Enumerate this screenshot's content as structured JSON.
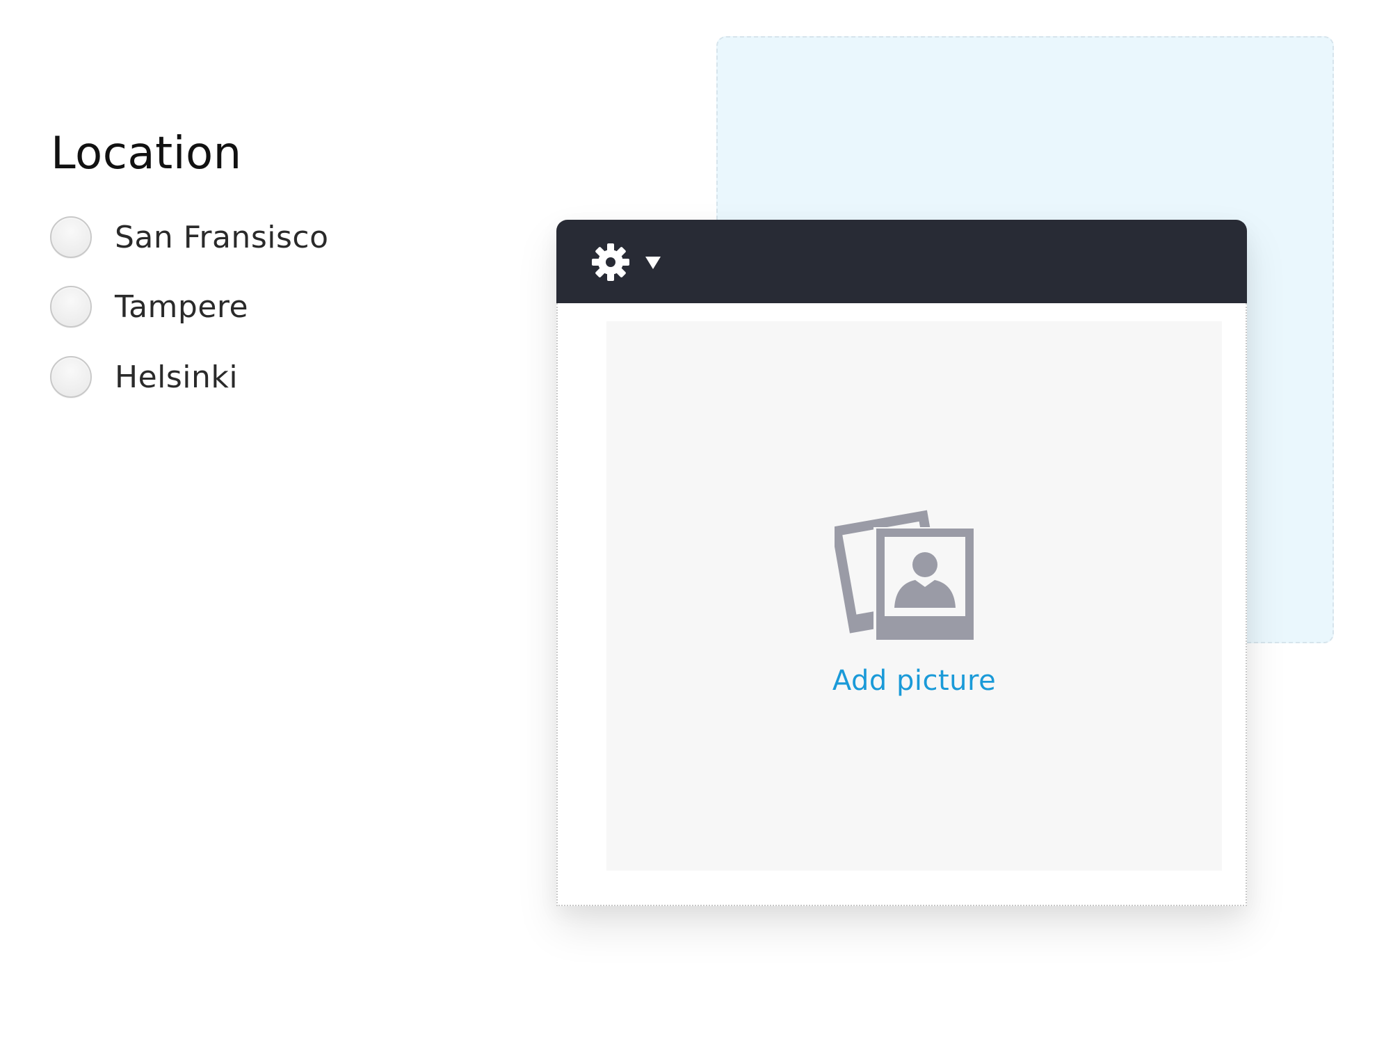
{
  "location": {
    "title": "Location",
    "options": [
      {
        "label": "San Fransisco",
        "selected": false
      },
      {
        "label": "Tampere",
        "selected": false
      },
      {
        "label": "Helsinki",
        "selected": false
      }
    ]
  },
  "widget": {
    "toolbar": {
      "icons": [
        "gear-icon",
        "caret-down-icon"
      ]
    },
    "add_picture_label": "Add picture",
    "placeholder_icon": "photos-icon"
  },
  "colors": {
    "toolbar_bg": "#282b35",
    "link": "#1a9ad8",
    "drop_zone_bg": "#eaf7fd",
    "picture_area_bg": "#f7f7f7",
    "icon_gray": "#9a9ba6"
  }
}
